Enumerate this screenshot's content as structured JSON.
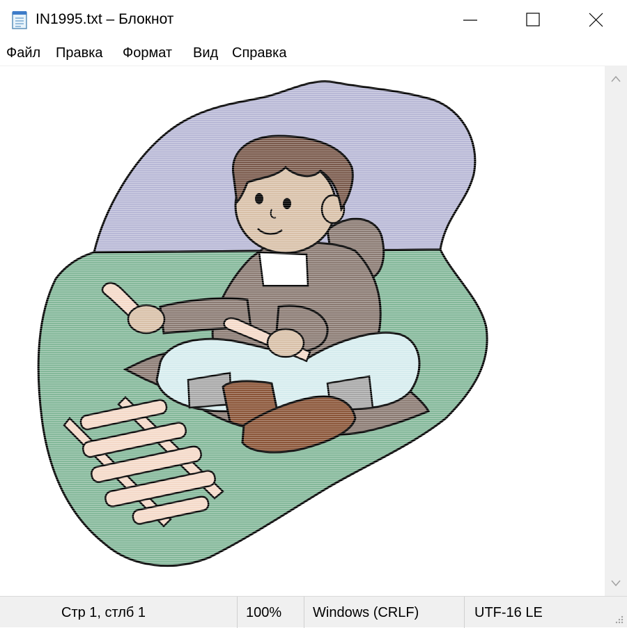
{
  "window": {
    "title": "IN1995.txt – Блокнот",
    "app_icon": "notepad-icon",
    "controls": [
      "minimize-icon",
      "maximize-icon",
      "close-icon"
    ]
  },
  "menu": {
    "items": [
      {
        "label": "Файл"
      },
      {
        "label": "Правка"
      },
      {
        "label": "Формат"
      },
      {
        "label": "Вид"
      },
      {
        "label": "Справка"
      }
    ]
  },
  "document": {
    "illustration": "child-sitting-with-sticks-clipart"
  },
  "status": {
    "position": "Стр 1, стлб 1",
    "zoom": "100%",
    "line_endings": "Windows (CRLF)",
    "encoding": "UTF-16 LE"
  },
  "colors": {
    "sky": "#b8b8d6",
    "grass": "#84b89a",
    "coat": "#8b7b73",
    "skin": "#d8c0a8",
    "hair": "#7a5a4c",
    "boots": "#8a5538",
    "sticks": "#f4d9c8",
    "pants": "#d6ecee"
  }
}
